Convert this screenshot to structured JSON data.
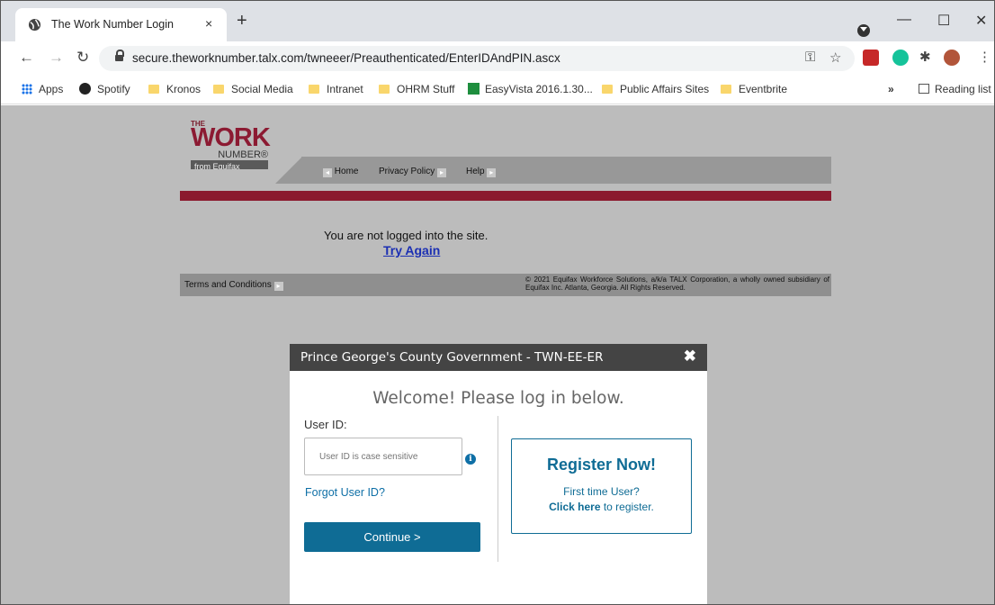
{
  "browser": {
    "tab_title": "The Work Number Login",
    "tab_close": "×",
    "new_tab": "+",
    "url": "secure.theworknumber.talx.com/twneeer/Preauthenticated/EnterIDAndPIN.ascx",
    "window_minimize": "—",
    "window_maximize": "☐",
    "window_close": "✕"
  },
  "bookmarks": {
    "items": [
      "Apps",
      "Spotify",
      "Kronos",
      "Social Media",
      "Intranet",
      "OHRM Stuff",
      "EasyVista 2016.1.30...",
      "Public Affairs Sites",
      "Eventbrite"
    ],
    "overflow": "»",
    "reading_list": "Reading list"
  },
  "site": {
    "logo_the": "THE",
    "logo_work": "WORK",
    "logo_number": "NUMBER®",
    "logo_from": "from Equifax",
    "nav": [
      "Home",
      "Privacy Policy",
      "Help"
    ],
    "not_logged": "You are not logged into the site.",
    "try_again": "Try Again",
    "terms": "Terms and Conditions",
    "copyright": "© 2021 Equifax Workforce Solutions, a/k/a TALX Corporation, a wholly owned subsidiary of Equifax Inc. Atlanta, Georgia. All Rights Reserved."
  },
  "modal": {
    "title": "Prince George's County Government - TWN-EE-ER",
    "close": "✖",
    "welcome": "Welcome! Please log in below.",
    "user_id_label": "User ID:",
    "user_id_placeholder": "User ID is case sensitive",
    "info": "i",
    "forgot": "Forgot User ID?",
    "continue": "Continue >",
    "register_title": "Register Now!",
    "register_first": "First time User?",
    "register_click": "Click here",
    "register_rest": " to register."
  },
  "colors": {
    "brand_red": "#8b1a2e",
    "brand_blue": "#0f6c95",
    "link_blue": "#1b2fb3"
  }
}
